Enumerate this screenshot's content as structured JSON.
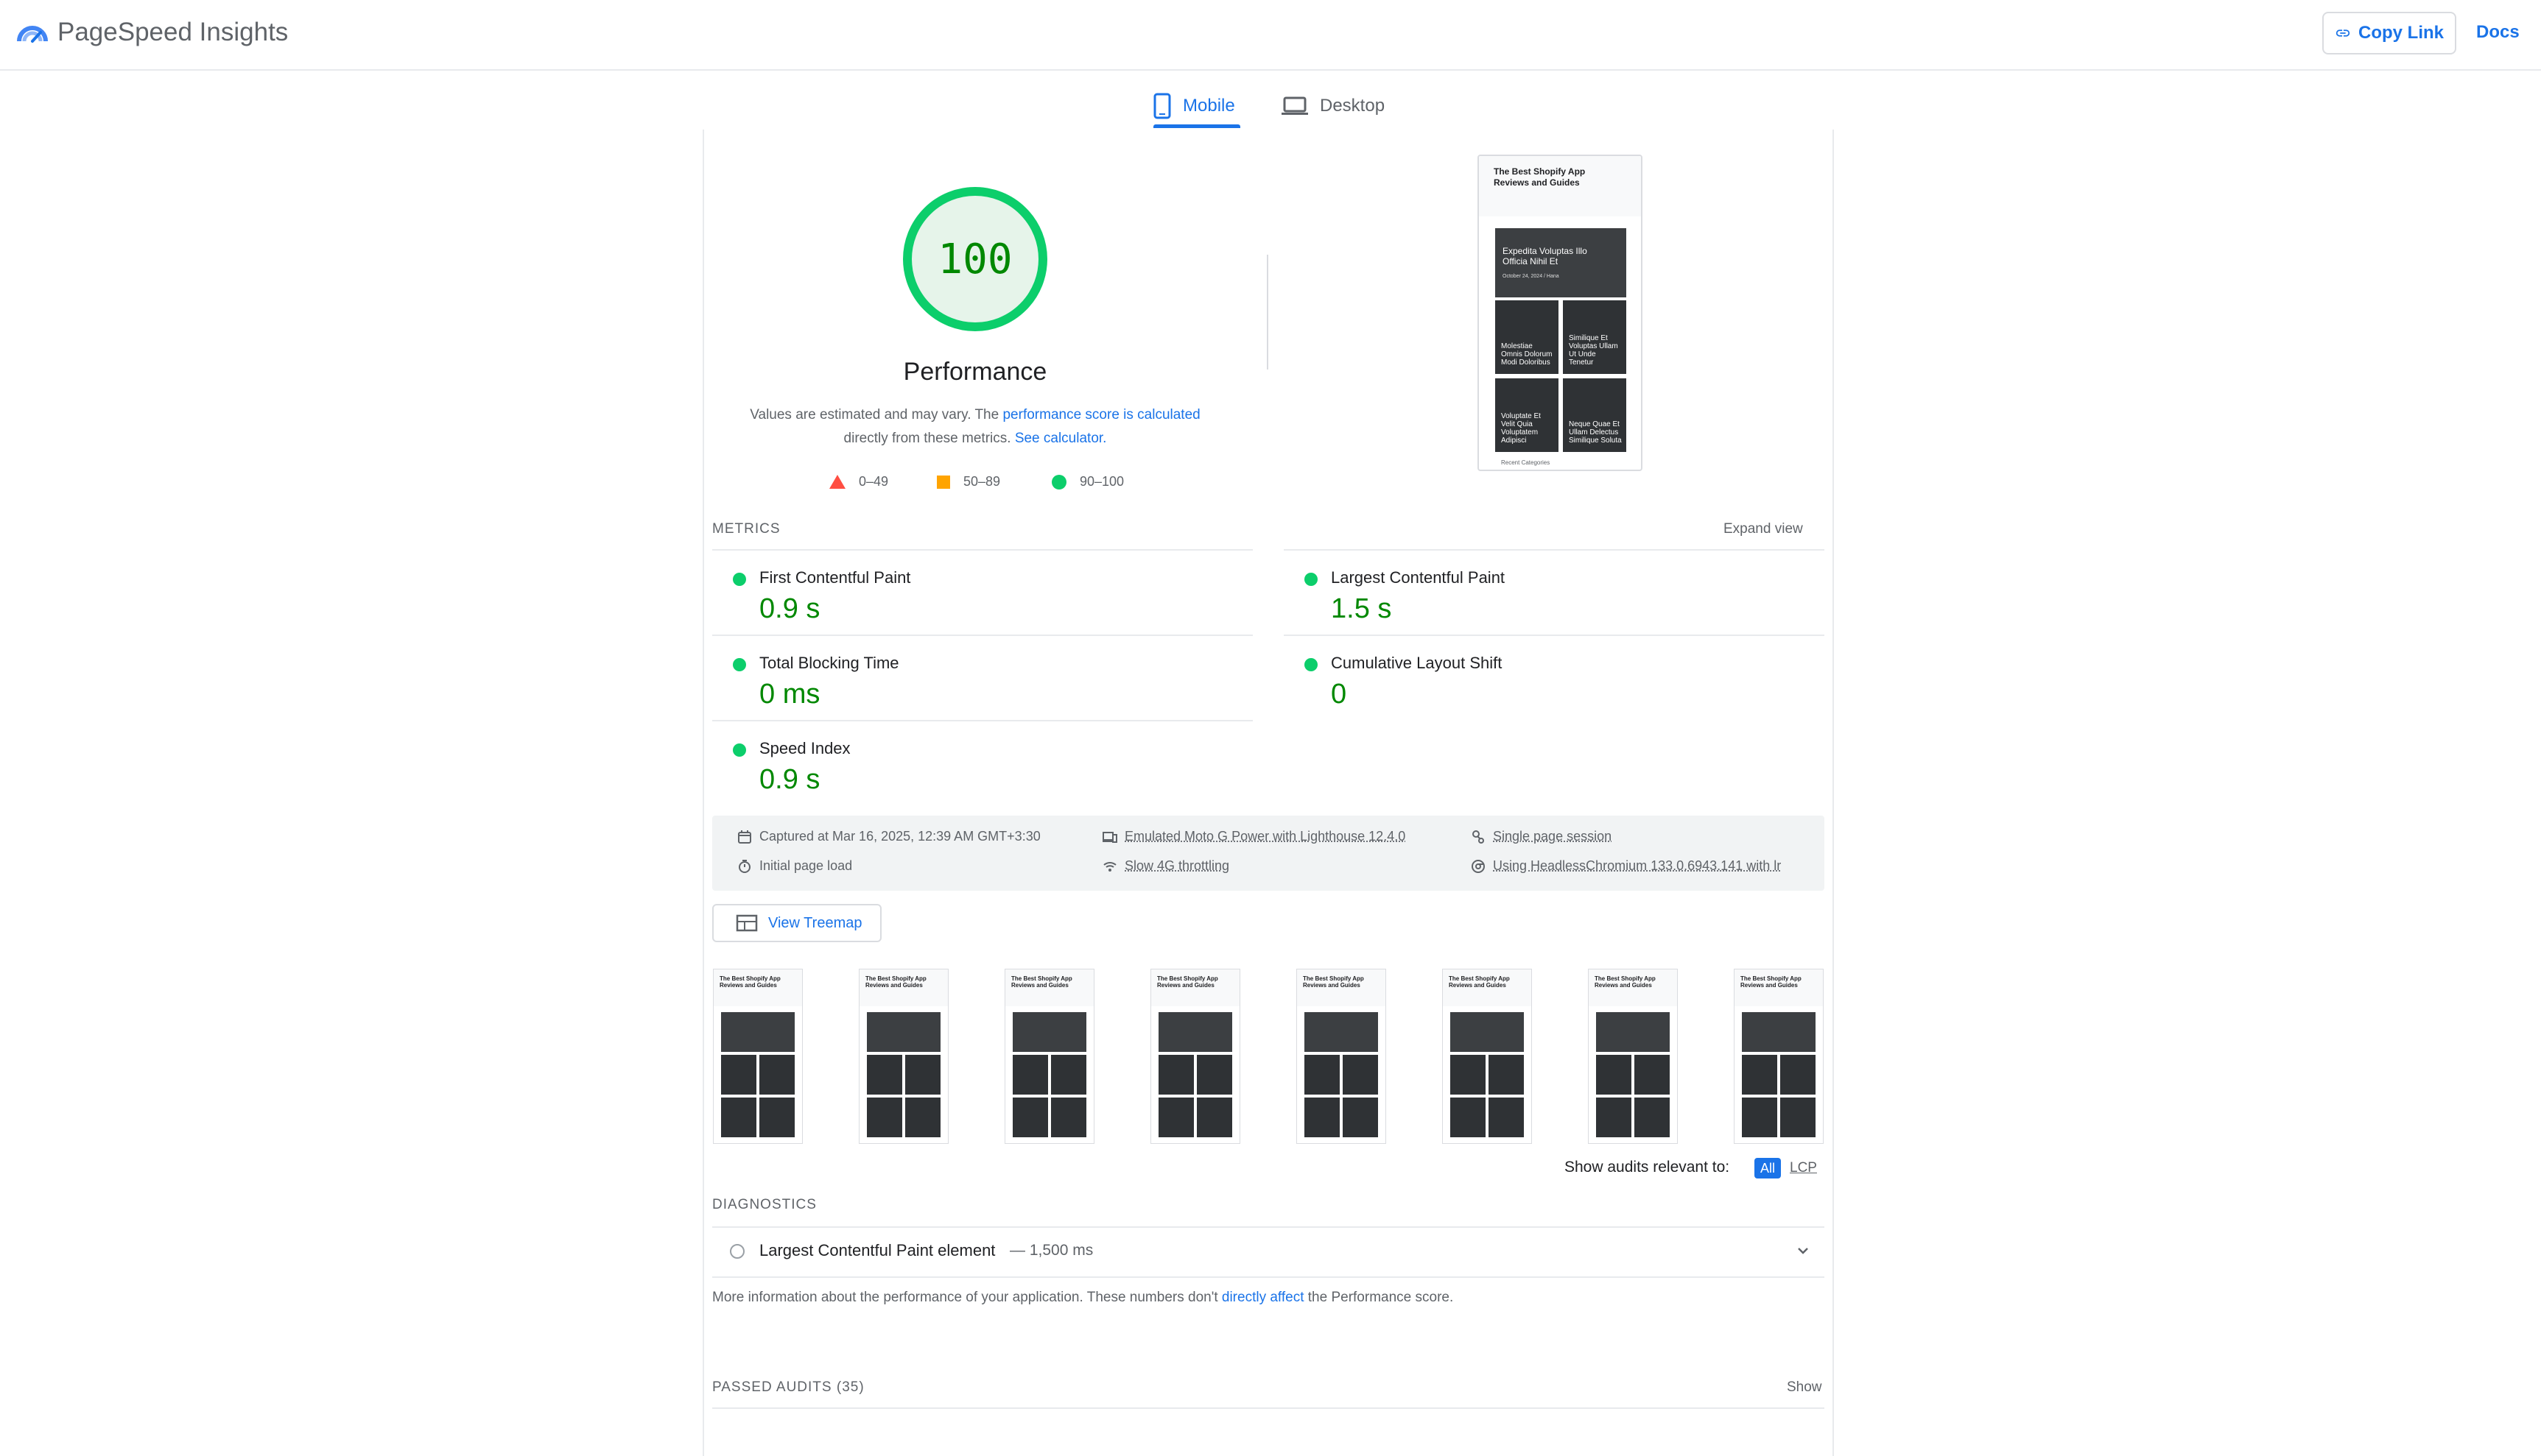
{
  "header": {
    "brand": "PageSpeed Insights",
    "copy_link": "Copy Link",
    "docs": "Docs"
  },
  "tabs": [
    {
      "label": "Mobile",
      "icon": "smartphone-icon",
      "selected": true
    },
    {
      "label": "Desktop",
      "icon": "laptop-icon",
      "selected": false
    }
  ],
  "score": {
    "value": "100",
    "title": "Performance",
    "desc_pre": "Values are estimated and may vary. The ",
    "desc_link1": "performance score is calculated",
    "desc_mid": "directly from these metrics. ",
    "desc_link2": "See calculator."
  },
  "legend": {
    "fail": "0–49",
    "average": "50–89",
    "pass": "90–100"
  },
  "final_screenshot": {
    "title": "The Best Shopify App Reviews and Guides",
    "hero": "Expedita Voluptas Illo Officia Nihil Et",
    "hero_date": "October 24, 2024 / Hana",
    "cells": [
      "Molestiae Omnis Dolorum Modi Doloribus",
      "Similique Et Voluptas Ullam Ut Unde Tenetur",
      "Voluptate Et Velit Quia Voluptatem Adipisci",
      "Neque Quae Et Ullam Delectus Similique Soluta"
    ],
    "footer": "Recent Categories"
  },
  "metrics": {
    "section_label": "METRICS",
    "expand_label": "Expand view",
    "items": [
      {
        "name": "First Contentful Paint",
        "value": "0.9 s"
      },
      {
        "name": "Largest Contentful Paint",
        "value": "1.5 s"
      },
      {
        "name": "Total Blocking Time",
        "value": "0 ms"
      },
      {
        "name": "Cumulative Layout Shift",
        "value": "0"
      },
      {
        "name": "Speed Index",
        "value": "0.9 s"
      }
    ]
  },
  "runtime": {
    "captured": "Captured at Mar 16, 2025, 12:39 AM GMT+3:30",
    "device": "Emulated Moto G Power with Lighthouse 12.4.0",
    "session": "Single page session",
    "load": "Initial page load",
    "throttling": "Slow 4G throttling",
    "browser": "Using HeadlessChromium 133.0.6943.141 with lr"
  },
  "treemap": "View Treemap",
  "filmstrip_title": "The Best Shopify App Reviews and Guides",
  "audits_filter": {
    "label": "Show audits relevant to:",
    "all": "All",
    "lcp": "LCP"
  },
  "diagnostics": {
    "label": "DIAGNOSTICS",
    "item_name": "Largest Contentful Paint element",
    "item_value": "— 1,500 ms",
    "note_pre": "More information about the performance of your application. These numbers don't ",
    "note_link": "directly affect",
    "note_post": " the Performance score."
  },
  "passed": {
    "label": "PASSED AUDITS",
    "count": "(35)",
    "show": "Show"
  },
  "colors": {
    "accent": "#1a73e8",
    "pass": "#0cce6b",
    "pass_text": "#008800",
    "average": "#ffa400",
    "fail": "#ff4e42"
  }
}
